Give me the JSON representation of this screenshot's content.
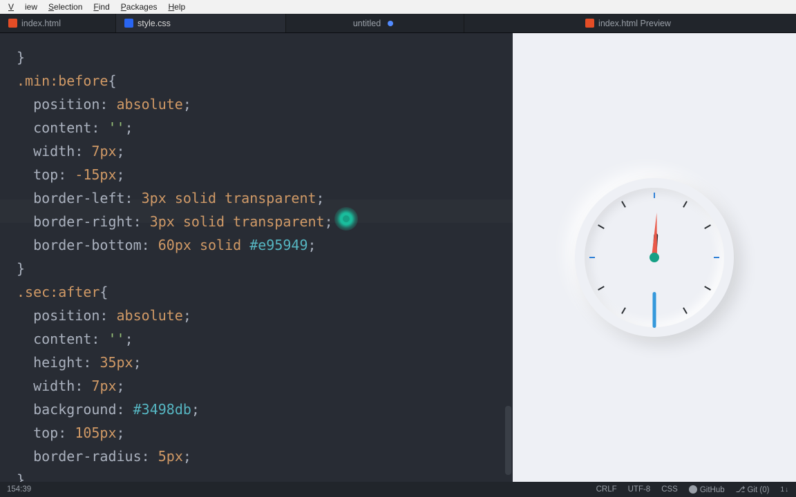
{
  "menubar": {
    "items": [
      "View",
      "Selection",
      "Find",
      "Packages",
      "Help"
    ]
  },
  "tabs": [
    {
      "label": "index.html",
      "icon": "html",
      "active": false,
      "modified": false
    },
    {
      "label": "style.css",
      "icon": "css",
      "active": true,
      "modified": false
    },
    {
      "label": "untitled",
      "icon": "",
      "active": false,
      "modified": true
    },
    {
      "label": "index.html Preview",
      "icon": "html",
      "active": false,
      "modified": false
    }
  ],
  "editor": {
    "language": "CSS",
    "cursor_pos": "154:39",
    "code_lines": [
      "}",
      ".min:before{",
      "  position: absolute;",
      "  content: '';",
      "  width: 7px;",
      "  top: -15px;",
      "  border-left: 3px solid transparent;",
      "  border-right: 3px solid transparent;",
      "  border-bottom: 60px solid #e95949;",
      "}",
      ".sec:after{",
      "  position: absolute;",
      "  content: '';",
      "  height: 35px;",
      "  width: 7px;",
      "  background: #3498db;",
      "  top: 105px;",
      "  border-radius: 5px;",
      "}"
    ]
  },
  "preview": {
    "clock": {
      "min_color": "#e95949",
      "sec_color": "#3498db",
      "center_color": "#16a085",
      "ticks": 12
    }
  },
  "status": {
    "left": "154:39",
    "right": {
      "eol": "CRLF",
      "encoding": "UTF-8",
      "lang": "CSS",
      "github": "GitHub",
      "git": "Git (0)",
      "updown": "1↓"
    }
  }
}
